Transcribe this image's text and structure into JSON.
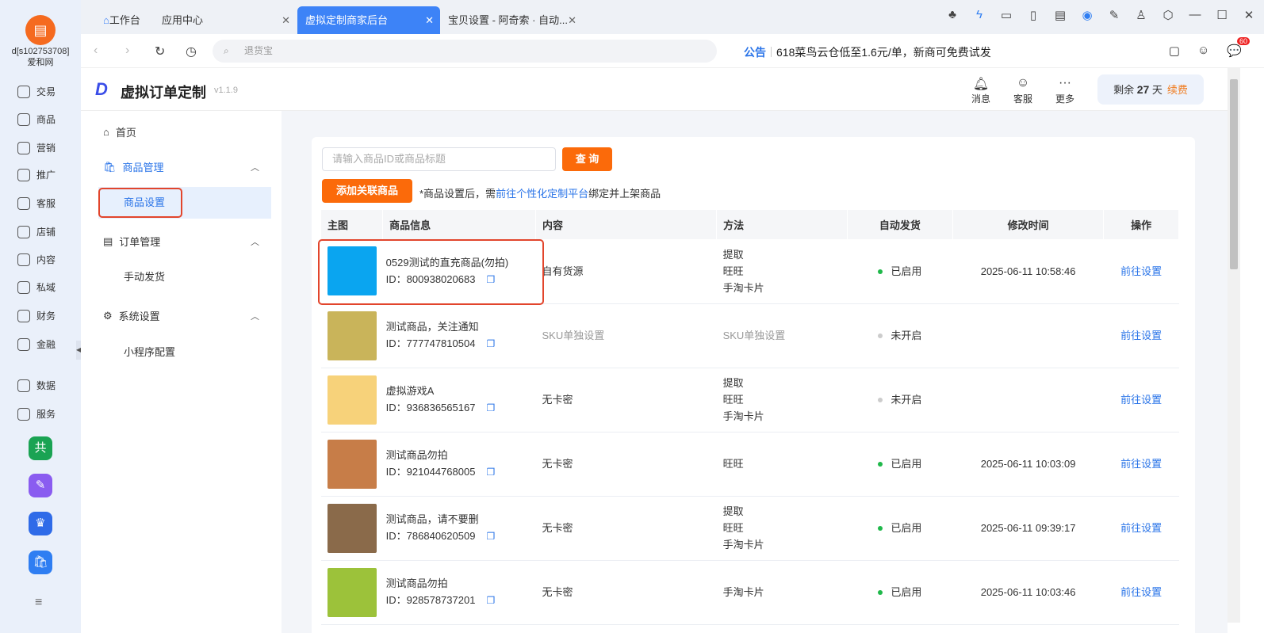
{
  "sidebar": {
    "user": "d[s102753708]",
    "shop": "爱和网",
    "items": [
      {
        "label": "交易",
        "icon": "clipboard-icon"
      },
      {
        "label": "商品",
        "icon": "bag-icon"
      },
      {
        "label": "营销",
        "icon": "megaphone-icon"
      },
      {
        "label": "推广",
        "icon": "bulb-icon"
      },
      {
        "label": "客服",
        "icon": "headset-icon"
      },
      {
        "label": "店铺",
        "icon": "store-icon"
      },
      {
        "label": "内容",
        "icon": "hash-icon"
      },
      {
        "label": "私域",
        "icon": "users-icon"
      },
      {
        "label": "财务",
        "icon": "yen-icon"
      },
      {
        "label": "金融",
        "icon": "coin-icon"
      },
      {
        "label": "数据",
        "icon": "chart-icon"
      },
      {
        "label": "服务",
        "icon": "grid-icon"
      }
    ],
    "apps": [
      {
        "glyph": "共",
        "color": "#1aa353"
      },
      {
        "glyph": "✎",
        "color": "#8a5cf0"
      },
      {
        "glyph": "♛",
        "color": "#2f6be8"
      },
      {
        "glyph": "🛍",
        "color": "#2f7ef2"
      }
    ]
  },
  "tabs": [
    {
      "label": "工作台"
    },
    {
      "label": "应用中心"
    },
    {
      "label": "虚拟定制商家后台"
    },
    {
      "label": "宝贝设置 - 阿奇索 · 自动..."
    }
  ],
  "address": {
    "search_placeholder": "退货宝",
    "notice_label": "公告",
    "notice_text": "618菜鸟云仓低至1.6元/单，新商可免费试发",
    "message_badge": "60"
  },
  "app": {
    "title": "虚拟订单定制",
    "version": "v1.1.9",
    "header_buttons": [
      {
        "label": "消息",
        "icon": "bell-icon"
      },
      {
        "label": "客服",
        "icon": "service-icon"
      },
      {
        "label": "更多",
        "icon": "more-icon"
      }
    ],
    "remain_prefix": "剩余",
    "remain_days": "27",
    "remain_suffix": "天",
    "renew": "续费"
  },
  "nav": {
    "home": "首页",
    "goods_mgmt": "商品管理",
    "goods_settings": "商品设置",
    "order_mgmt": "订单管理",
    "manual_ship": "手动发货",
    "sys_settings": "系统设置",
    "miniapp": "小程序配置"
  },
  "toolbar": {
    "search_placeholder": "请输入商品ID或商品标题",
    "query": "查 询",
    "add": "添加关联商品",
    "tip_prefix": "*商品设置后，需",
    "tip_link": "前往个性化定制平台",
    "tip_suffix": "绑定并上架商品"
  },
  "table": {
    "columns": [
      "主图",
      "商品信息",
      "内容",
      "方法",
      "自动发货",
      "修改时间",
      "操作"
    ],
    "rows": [
      {
        "title": "0529测试的直充商品(勿拍)",
        "id": "ID：800938020683",
        "content": "自有货源",
        "methods": [
          "提取",
          "旺旺",
          "手淘卡片"
        ],
        "status": "已启用",
        "time": "2025-06-11 10:58:46",
        "action": "前往设置",
        "thumb": "#0aa5f0"
      },
      {
        "title": "测试商品，关注通知",
        "id": "ID：777747810504",
        "content": "SKU单独设置",
        "methods": [
          "SKU单独设置"
        ],
        "status": "未开启",
        "time": "",
        "action": "前往设置",
        "thumb": "#c9b45a"
      },
      {
        "title": "虚拟游戏A",
        "id": "ID：936836565167",
        "content": "无卡密",
        "methods": [
          "提取",
          "旺旺",
          "手淘卡片"
        ],
        "status": "未开启",
        "time": "",
        "action": "前往设置",
        "thumb": "#f7d27a"
      },
      {
        "title": "测试商品勿拍",
        "id": "ID：921044768005",
        "content": "无卡密",
        "methods": [
          "旺旺"
        ],
        "status": "已启用",
        "time": "2025-06-11 10:03:09",
        "action": "前往设置",
        "thumb": "#c77d48"
      },
      {
        "title": "测试商品，请不要删",
        "id": "ID：786840620509",
        "content": "无卡密",
        "methods": [
          "提取",
          "旺旺",
          "手淘卡片"
        ],
        "status": "已启用",
        "time": "2025-06-11 09:39:17",
        "action": "前往设置",
        "thumb": "#8a6a4a"
      },
      {
        "title": "测试商品勿拍",
        "id": "ID：928578737201",
        "content": "无卡密",
        "methods": [
          "手淘卡片"
        ],
        "status": "已启用",
        "time": "2025-06-11 10:03:46",
        "action": "前往设置",
        "thumb": "#9cc23a"
      }
    ]
  },
  "colors": {
    "accent": "#3d83f7",
    "orange": "#fb6a0a",
    "enabled": "#1fb84a",
    "disabled": "#cccccc"
  }
}
